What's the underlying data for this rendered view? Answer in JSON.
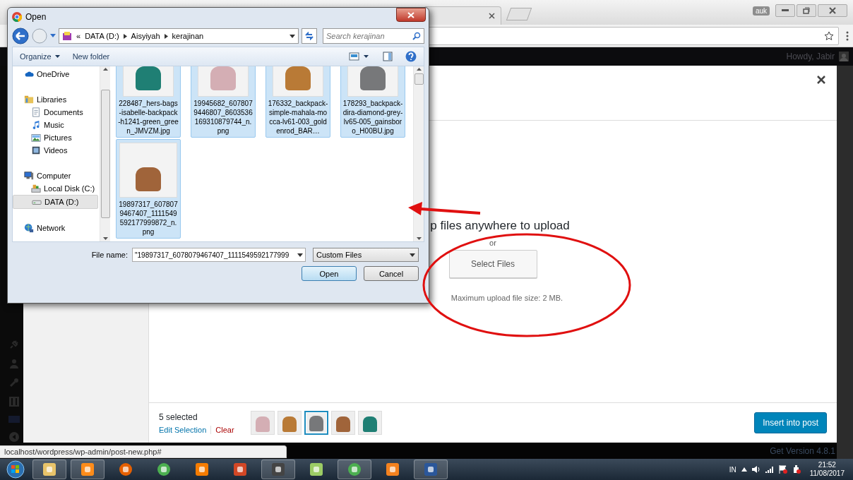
{
  "browser": {
    "profile": "auk"
  },
  "admin_bar": {
    "greeting": "Howdy, Jabir"
  },
  "media_modal": {
    "uploader": {
      "drop_text": "p files anywhere to upload",
      "or": "or",
      "button": "Select Files",
      "max_size": "Maximum upload file size: 2 MB."
    },
    "toolbar": {
      "count": "5 selected",
      "edit": "Edit Selection",
      "clear": "Clear",
      "insert": "Insert into post",
      "thumbnails": [
        {
          "color": "#d4aeb4",
          "selected": false
        },
        {
          "color": "#b97a36",
          "selected": false
        },
        {
          "color": "#77787a",
          "selected": true
        },
        {
          "color": "#a0643a",
          "selected": false
        },
        {
          "color": "#1f7f74",
          "selected": false
        }
      ]
    }
  },
  "footer_version": "Get Version 4.8.1",
  "status_url": "localhost/wordpress/wp-admin/post-new.php#",
  "open_dialog": {
    "title": "Open",
    "breadcrumb_prefix": "«",
    "breadcrumb": [
      "DATA (D:)",
      "Aisyiyah",
      "kerajinan"
    ],
    "search_placeholder": "Search kerajinan",
    "toolbar": [
      {
        "label": "Organize",
        "caret": true
      },
      {
        "label": "New folder",
        "caret": false
      }
    ],
    "nav": [
      {
        "label": "OneDrive",
        "selected": false
      },
      {
        "label": "Libraries",
        "selected": false,
        "children": [
          {
            "label": "Documents",
            "selected": false
          },
          {
            "label": "Music",
            "selected": false
          },
          {
            "label": "Pictures",
            "selected": false
          },
          {
            "label": "Videos",
            "selected": false
          }
        ]
      },
      {
        "label": "Computer",
        "selected": false,
        "children": [
          {
            "label": "Local Disk (C:)",
            "selected": false
          },
          {
            "label": "DATA (D:)",
            "selected": true
          }
        ]
      },
      {
        "label": "Network",
        "selected": false
      }
    ],
    "files": [
      {
        "name": "228487_hers-bags-isabelle-backpack-h1241-green_green_JMVZM.jpg",
        "color": "#1f7f74",
        "selected": true
      },
      {
        "name": "19945682_6078079446807_8603536169310879744_n.png",
        "color": "#d4aeb4",
        "selected": true
      },
      {
        "name": "176332_backpack-simple-mahala-mocca-lv61-003_goldenrod_BAR…",
        "color": "#b97a36",
        "selected": true
      },
      {
        "name": "178293_backpack-dira-diamond-grey-lv65-005_gainsboro_H00BU.jpg",
        "color": "#77787a",
        "selected": true
      },
      {
        "name": "19897317_6078079467407_1111549592177999872_n.png",
        "color": "#a0643a",
        "selected": true
      }
    ],
    "file_name_label": "File name:",
    "file_name": "\"19897317_6078079467407_1111549592177999",
    "filter": "Custom Files",
    "open": "Open",
    "cancel": "Cancel"
  },
  "taskbar": {
    "language": "IN",
    "time": "21:52",
    "date": "11/08/2017"
  }
}
